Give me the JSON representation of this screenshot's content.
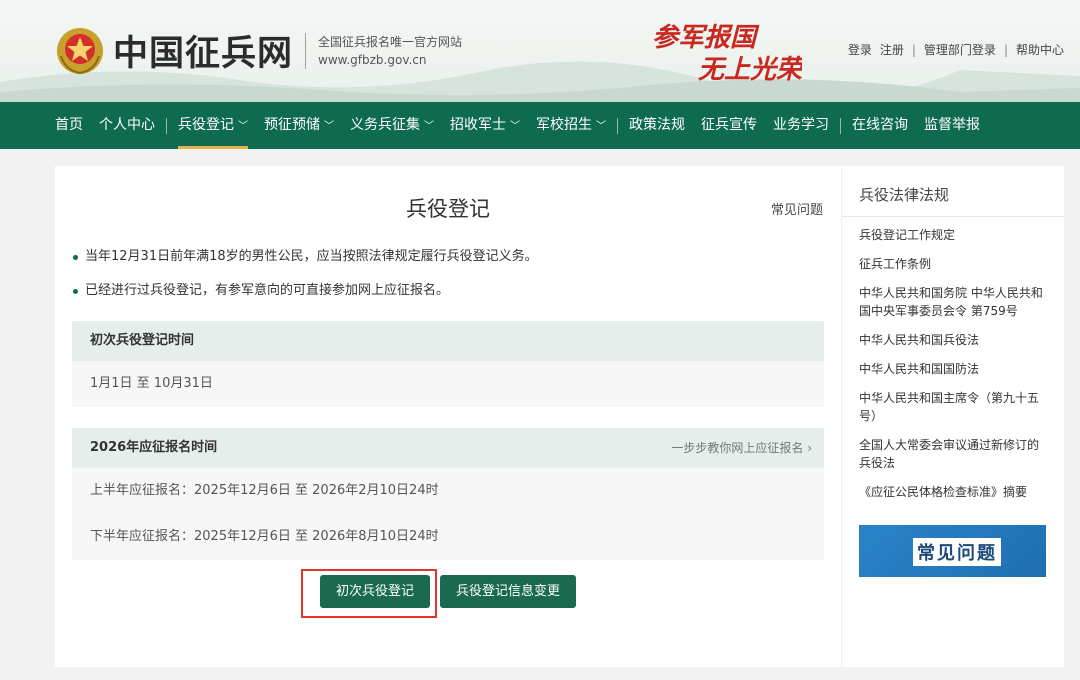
{
  "header": {
    "site_name": "中国征兵网",
    "subtitle": "全国征兵报名唯一官方网站",
    "domain": "www.gfbzb.gov.cn",
    "slogan_line1": "参军报国",
    "slogan_line2": "无上光荣",
    "links": {
      "login": "登录",
      "register": "注册",
      "dept_login": "管理部门登录",
      "help": "帮助中心"
    }
  },
  "nav": {
    "items": [
      "首页",
      "个人中心",
      "兵役登记",
      "预征预储",
      "义务兵征集",
      "招收军士",
      "军校招生",
      "政策法规",
      "征兵宣传",
      "业务学习",
      "在线咨询",
      "监督举报"
    ]
  },
  "main": {
    "title": "兵役登记",
    "faq": "常见问题",
    "bullets": [
      "当年12月31日前年满18岁的男性公民，应当按照法律规定履行兵役登记义务。",
      "已经进行过兵役登记，有参军意向的可直接参加网上应征报名。"
    ],
    "card1": {
      "title": "初次兵役登记时间",
      "row": "1月1日 至 10月31日"
    },
    "card2": {
      "title": "2026年应征报名时间",
      "link": "一步步教你网上应征报名 ›",
      "row1": "上半年应征报名：2025年12月6日 至 2026年2月10日24时",
      "row2": "下半年应征报名：2025年12月6日 至 2026年8月10日24时"
    },
    "buttons": {
      "first": "初次兵役登记",
      "change": "兵役登记信息变更"
    }
  },
  "sidebar": {
    "title": "兵役法律法规",
    "links": [
      "兵役登记工作规定",
      "征兵工作条例",
      "中华人民共和国务院 中华人民共和国中央军事委员会令 第759号",
      "中华人民共和国兵役法",
      "中华人民共和国国防法",
      "中华人民共和国主席令（第九十五号）",
      "全国人大常委会审议通过新修订的兵役法",
      "《应征公民体格检查标准》摘要"
    ],
    "banner": "常见问题"
  },
  "colors": {
    "nav_green": "#0f6b4f",
    "nav_active": "#e8b04a",
    "button": "#1a6a4f",
    "highlight": "#e0362c"
  }
}
